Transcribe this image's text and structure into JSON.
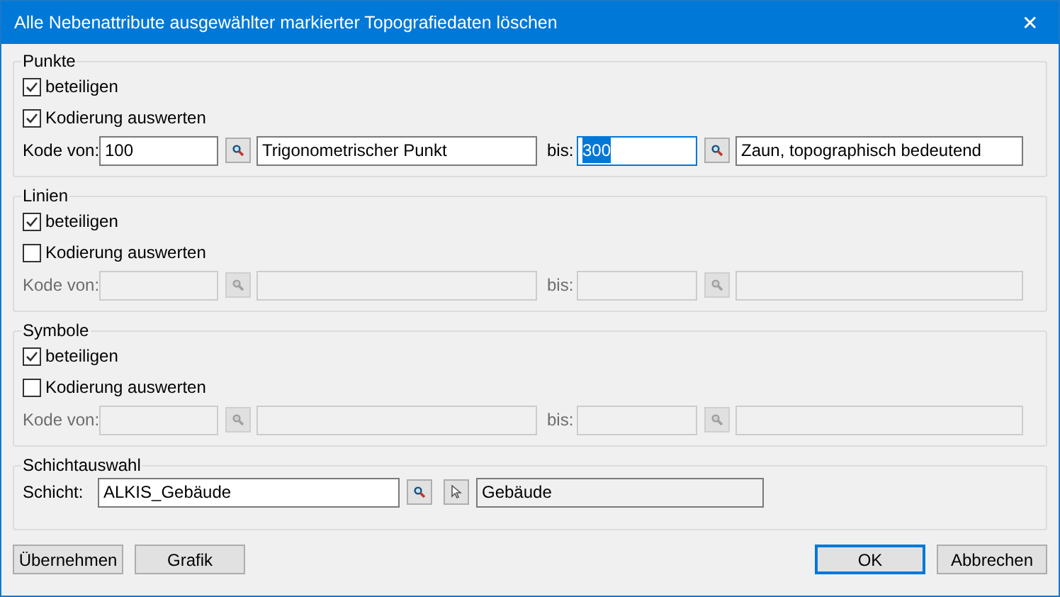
{
  "window": {
    "title": "Alle Nebenattribute ausgewählter markierter Topografiedaten löschen",
    "close": "✕"
  },
  "groups": [
    {
      "title": "Punkte",
      "checkboxes": [
        {
          "label": "beteiligen",
          "checked": true
        },
        {
          "label": "Kodierung auswerten",
          "checked": true
        }
      ],
      "code": {
        "label": "Kode von:",
        "disabled": false,
        "from": {
          "value": "100",
          "focused": false
        },
        "from_desc": "Trigonometrischer Punkt",
        "to_label": "bis:",
        "to": {
          "value": "300",
          "focused": true
        },
        "to_desc": "Zaun, topographisch bedeutend"
      }
    },
    {
      "title": "Linien",
      "checkboxes": [
        {
          "label": "beteiligen",
          "checked": true
        },
        {
          "label": "Kodierung auswerten",
          "checked": false
        }
      ],
      "code": {
        "label": "Kode von:",
        "disabled": true,
        "to_label": "bis:"
      }
    },
    {
      "title": "Symbole",
      "checkboxes": [
        {
          "label": "beteiligen",
          "checked": true
        },
        {
          "label": "Kodierung auswerten",
          "checked": false
        }
      ],
      "code": {
        "label": "Kode von:",
        "disabled": true,
        "to_label": "bis:"
      }
    }
  ],
  "layer": {
    "title": "Schichtauswahl",
    "label": "Schicht:",
    "value": "ALKIS_Gebäude",
    "description": "Gebäude"
  },
  "buttons_left": [
    {
      "label": "Übernehmen",
      "default": false
    },
    {
      "label": "Grafik",
      "default": false
    }
  ],
  "buttons_right": [
    {
      "label": "OK",
      "default": true
    },
    {
      "label": "Abbrechen",
      "default": false
    }
  ]
}
